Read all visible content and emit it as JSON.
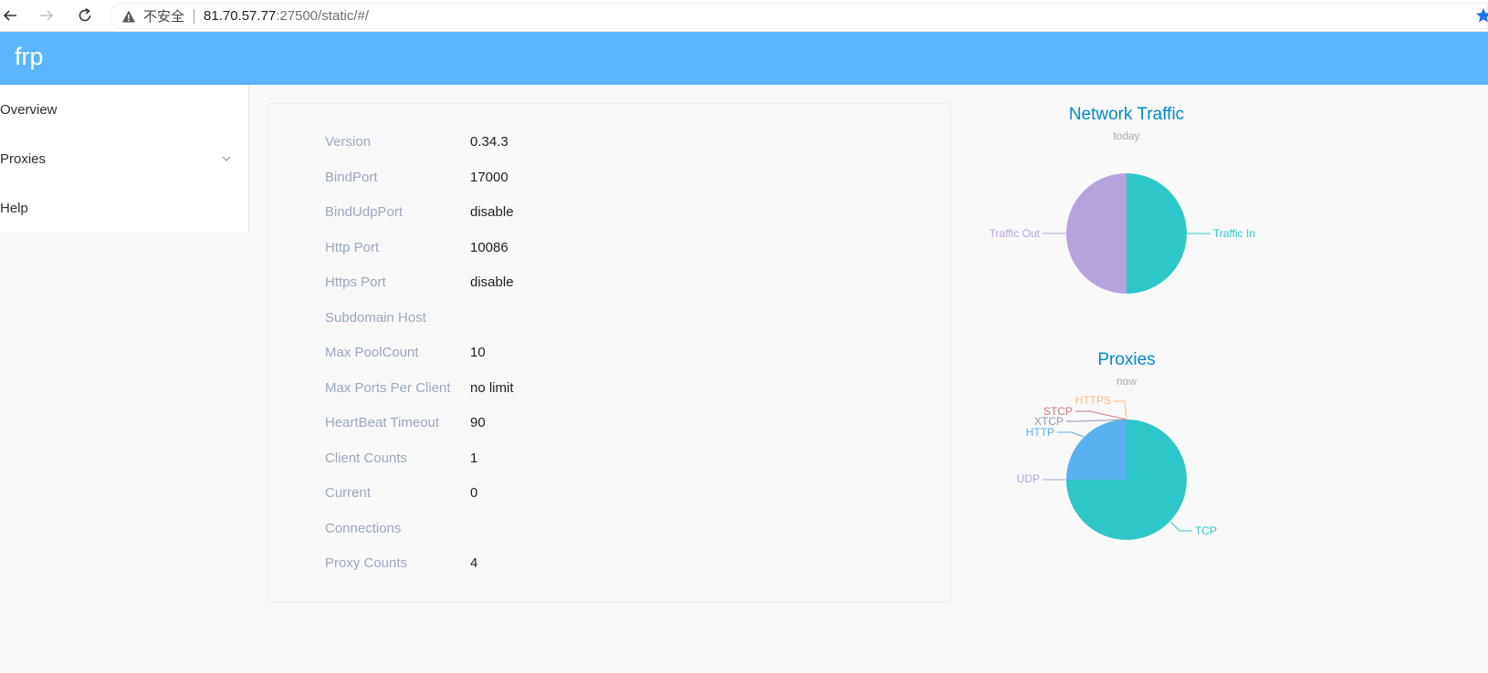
{
  "browser": {
    "back_icon": "arrow-left-icon",
    "forward_icon": "arrow-right-icon",
    "reload_icon": "reload-icon",
    "security_label": "不安全",
    "url_host": "81.70.57.77",
    "url_path": ":27500/static/#/"
  },
  "header": {
    "title": "frp"
  },
  "sidebar": {
    "items": [
      {
        "label": "Overview"
      },
      {
        "label": "Proxies"
      },
      {
        "label": "Help"
      }
    ]
  },
  "server_info": [
    {
      "label": "Version",
      "value": "0.34.3"
    },
    {
      "label": "BindPort",
      "value": "17000"
    },
    {
      "label": "BindUdpPort",
      "value": "disable"
    },
    {
      "label": "Http Port",
      "value": "10086"
    },
    {
      "label": "Https Port",
      "value": "disable"
    },
    {
      "label": "Subdomain Host",
      "value": ""
    },
    {
      "label": "Max PoolCount",
      "value": "10"
    },
    {
      "label": "Max Ports Per Client",
      "value": "no limit"
    },
    {
      "label": "HeartBeat Timeout",
      "value": "90"
    },
    {
      "label": "Client Counts",
      "value": "1"
    },
    {
      "label": "Current",
      "value": "0"
    },
    {
      "label": "Connections",
      "value": ""
    },
    {
      "label": "Proxy Counts",
      "value": "4"
    }
  ],
  "chart_data": [
    {
      "type": "pie",
      "title": "Network Traffic",
      "subtitle": "today",
      "slices": [
        {
          "name": "Traffic In",
          "value": 50,
          "color": "#2ec7c9"
        },
        {
          "name": "Traffic Out",
          "value": 50,
          "color": "#b6a2de"
        }
      ]
    },
    {
      "type": "pie",
      "title": "Proxies",
      "subtitle": "now",
      "slices": [
        {
          "name": "TCP",
          "value": 3,
          "color": "#2ec7c9"
        },
        {
          "name": "UDP",
          "value": 0,
          "color": "#b6a2de"
        },
        {
          "name": "HTTP",
          "value": 1,
          "color": "#5ab1ef"
        },
        {
          "name": "XTCP",
          "value": 0,
          "color": "#8d98b3"
        },
        {
          "name": "STCP",
          "value": 0,
          "color": "#d87a80"
        },
        {
          "name": "HTTPS",
          "value": 0,
          "color": "#ffb980"
        }
      ]
    }
  ],
  "colors": {
    "header": "#5bb6ff",
    "chart_title": "#008acd",
    "label": "#99a9bf"
  }
}
